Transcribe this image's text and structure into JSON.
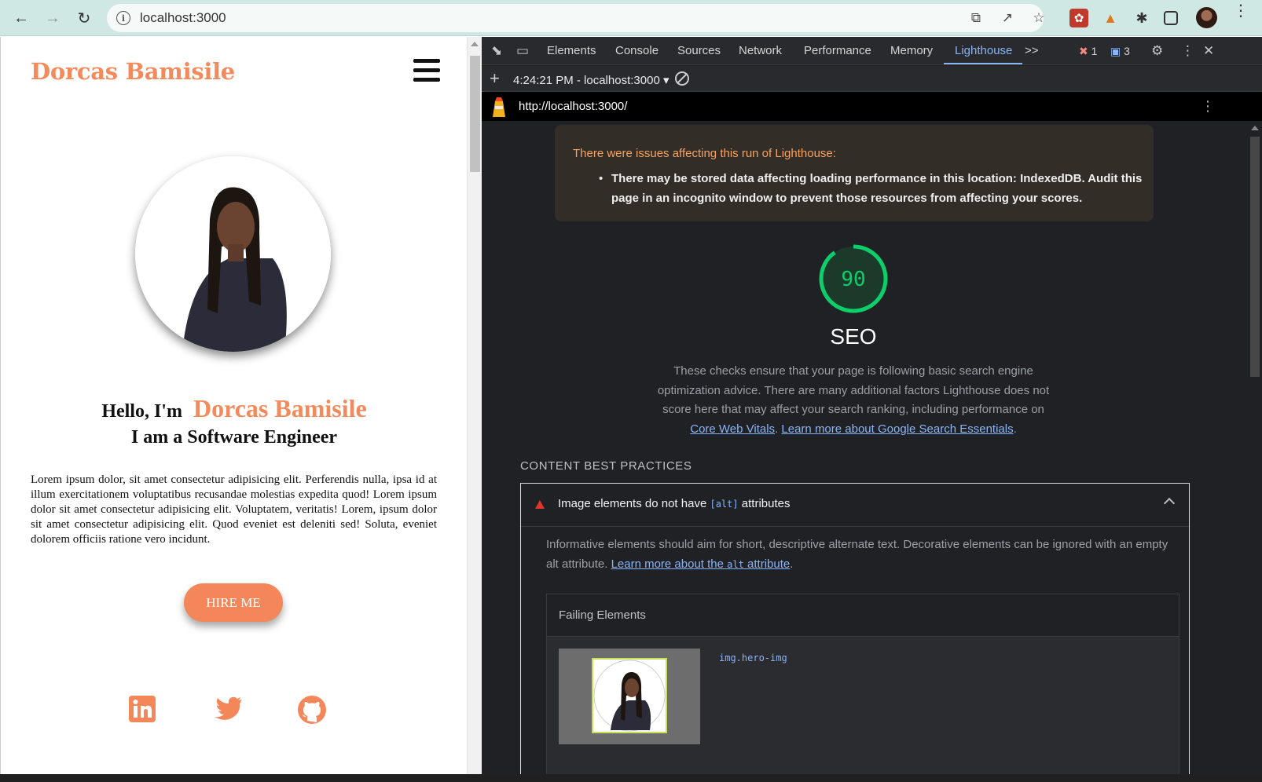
{
  "browser": {
    "url": "localhost:3000",
    "icons": [
      "back-icon",
      "forward-icon",
      "reload-icon",
      "info-icon",
      "open-in-app-icon",
      "share-icon",
      "bookmark-star-icon",
      "extension-icon",
      "metamask-icon",
      "puzzle-icon",
      "side-panel-icon",
      "profile-avatar",
      "kebab-menu-icon"
    ]
  },
  "site": {
    "logo": "Dorcas Bamisile",
    "hello_prefix": "Hello, I'm",
    "hello_name": "Dorcas Bamisile",
    "subtitle": "I am a Software Engineer",
    "paragraph": "Lorem ipsum dolor, sit amet consectetur adipisicing elit. Perferendis nulla, ipsa id at illum exercitationem voluptatibus recusandae molestias expedita quod! Lorem ipsum dolor sit amet consectetur adipisicing elit. Voluptatem, veritatis! Lorem, ipsum dolor sit amet consectetur adipisicing elit. Quod eveniet est deleniti sed! Soluta, eveniet dolorem officiis ratione vero incidunt.",
    "hire_button": "HIRE ME",
    "accent": "#f28a5c",
    "social_icons": [
      "linkedin-icon",
      "twitter-icon",
      "github-icon"
    ]
  },
  "devtools": {
    "tabs": [
      "Elements",
      "Console",
      "Sources",
      "Network",
      "Performance",
      "Memory",
      "Lighthouse"
    ],
    "active_tab": "Lighthouse",
    "more_tabs": ">>",
    "error_count": "1",
    "message_count": "3",
    "report_select": "4:24:21 PM - localhost:3000",
    "report_url": "http://localhost:3000/",
    "warning": {
      "title": "There were issues affecting this run of Lighthouse:",
      "item": "There may be stored data affecting loading performance in this location: IndexedDB. Audit this page in an incognito window to prevent those resources from affecting your scores."
    },
    "score": {
      "value": 90,
      "label": "SEO",
      "color": "#0cce6b",
      "description": "These checks ensure that your page is following basic search engine optimization advice. There are many additional factors Lighthouse does not score here that may affect your search ranking, including performance on",
      "link1": "Core Web Vitals",
      "sep": ".",
      "link2": "Learn more about Google Search Essentials",
      "end": "."
    },
    "section_title": "CONTENT BEST PRACTICES",
    "audit": {
      "title_pre": "Image elements do not have",
      "title_code": "[alt]",
      "title_post": "attributes",
      "description": "Informative elements should aim for short, descriptive alternate text. Decorative elements can be ignored with an empty alt attribute.",
      "link_pre": "Learn more about the",
      "link_code": "alt",
      "link_post": "attribute",
      "period": ".",
      "failing_title": "Failing Elements",
      "selector": "img.hero-img"
    }
  }
}
